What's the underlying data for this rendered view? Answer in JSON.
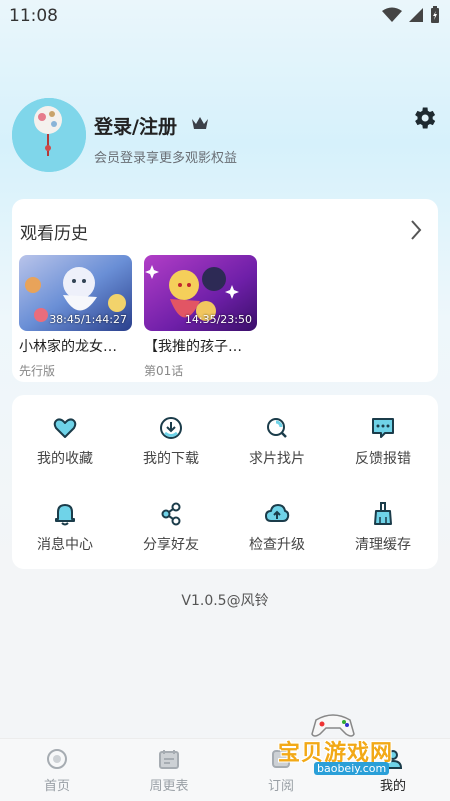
{
  "status_bar": {
    "time": "11:08"
  },
  "profile": {
    "login_label": "登录/注册",
    "subtitle": "会员登录享更多观影权益"
  },
  "history": {
    "title": "观看历史",
    "items": [
      {
        "progress": "38:45/1:44:27",
        "title": "小林家的龙女…",
        "subtitle": "先行版"
      },
      {
        "progress": "14:35/23:50",
        "title": "【我推的孩子…",
        "subtitle": "第01话"
      }
    ]
  },
  "menu": [
    {
      "label": "我的收藏",
      "icon": "heart-icon"
    },
    {
      "label": "我的下载",
      "icon": "download-icon"
    },
    {
      "label": "求片找片",
      "icon": "search-film-icon"
    },
    {
      "label": "反馈报错",
      "icon": "feedback-icon"
    },
    {
      "label": "消息中心",
      "icon": "bell-icon"
    },
    {
      "label": "分享好友",
      "icon": "share-icon"
    },
    {
      "label": "检查升级",
      "icon": "cloud-upload-icon"
    },
    {
      "label": "清理缓存",
      "icon": "broom-icon"
    }
  ],
  "version": "V1.0.5@风铃",
  "tabs": [
    {
      "label": "首页"
    },
    {
      "label": "周更表"
    },
    {
      "label": "订阅"
    },
    {
      "label": "我的"
    }
  ],
  "watermark": {
    "text": "宝贝游戏网",
    "url": "baobeiy.com"
  },
  "colors": {
    "accent": "#1ea7c4",
    "icon_stroke": "#1b3c4a",
    "icon_fill": "#6fd3e8"
  }
}
